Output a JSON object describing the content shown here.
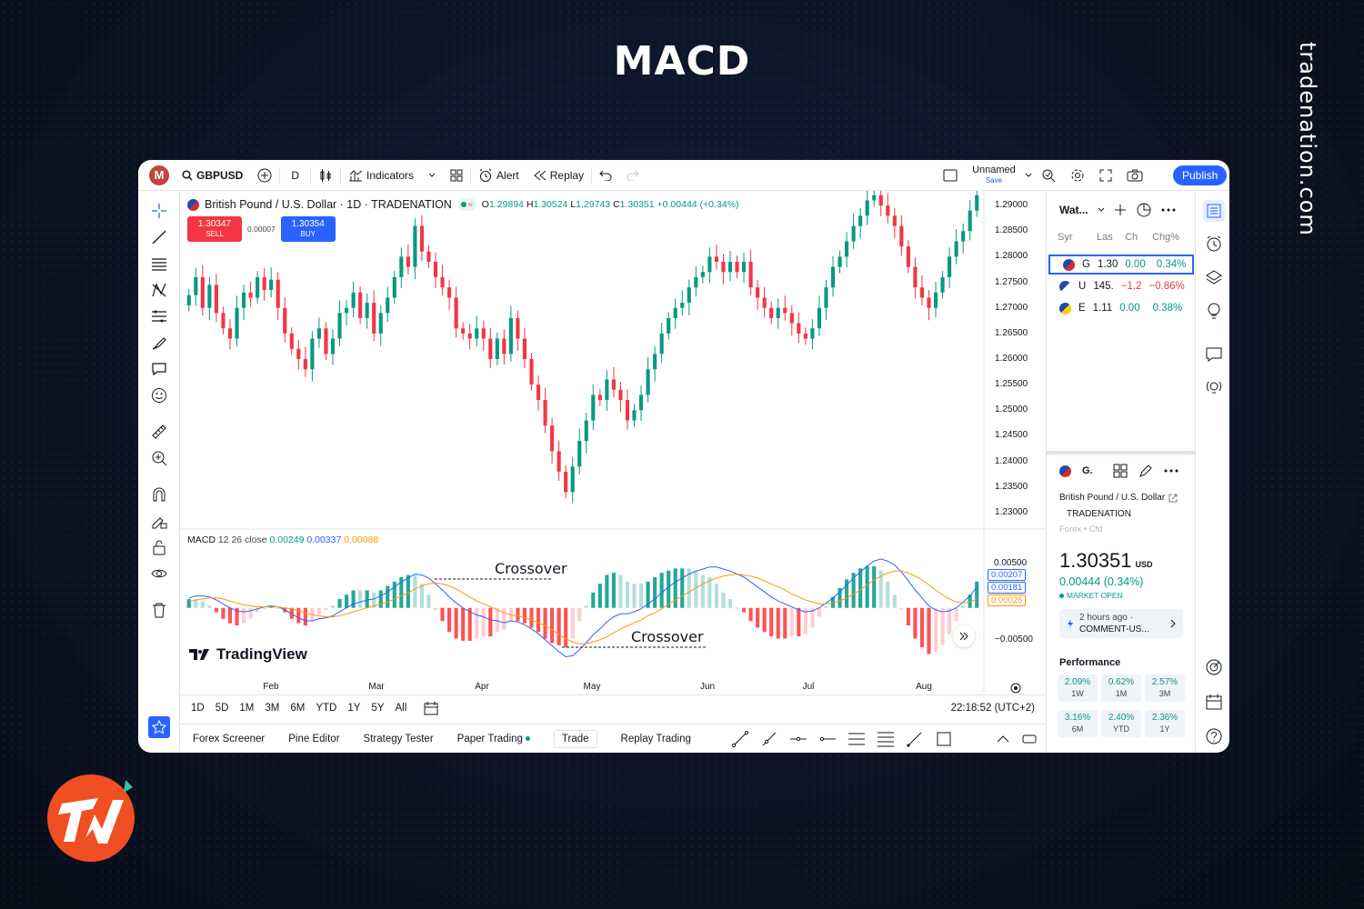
{
  "page": {
    "headline": "MACD",
    "brand": "tradenation.com"
  },
  "topbar": {
    "avatar": "M",
    "symbol": "GBPUSD",
    "interval": "D",
    "indicators": "Indicators",
    "alert": "Alert",
    "replay": "Replay",
    "layout_name": "Unnamed",
    "layout_sub": "Save",
    "publish": "Publish"
  },
  "legend": {
    "title": "British Pound / U.S. Dollar · 1D · TRADENATION",
    "o_label": "O",
    "o": "1.29894",
    "h_label": "H",
    "h": "1.30524",
    "l_label": "L",
    "l": "1.29743",
    "c_label": "C",
    "c": "1.30351",
    "chg": "+0.00444 (+0.34%)"
  },
  "trade": {
    "sell_price": "1.30347",
    "sell_label": "SELL",
    "spread": "0.00007",
    "buy_price": "1.30354",
    "buy_label": "BUY"
  },
  "macd_legend": {
    "label": "MACD",
    "params": "12 26 close",
    "macd": "0.00249",
    "signal": "0.00337",
    "hist": "0.00088"
  },
  "annotations": {
    "cross1": "Crossover",
    "cross2": "Crossover"
  },
  "tv_logo": "TradingView",
  "price_axis": [
    "1.29000",
    "1.28500",
    "1.28000",
    "1.27500",
    "1.27000",
    "1.26500",
    "1.26000",
    "1.25500",
    "1.25000",
    "1.24500",
    "1.24000",
    "1.23500",
    "1.23000"
  ],
  "macd_axis": [
    "0.00500",
    "−0.00500"
  ],
  "macd_tags": [
    "0.00207",
    "0.00181",
    "0.00026"
  ],
  "time_axis": [
    "Feb",
    "Mar",
    "Apr",
    "May",
    "Jun",
    "Jul",
    "Aug"
  ],
  "ranges": [
    "1D",
    "5D",
    "1M",
    "3M",
    "6M",
    "YTD",
    "1Y",
    "5Y",
    "All"
  ],
  "clock": "22:18:52 (UTC+2)",
  "bottom_tabs": [
    "Forex Screener",
    "Pine Editor",
    "Strategy Tester",
    "Paper Trading",
    "Trade",
    "Replay Trading"
  ],
  "watchlist": {
    "title": "Wat...",
    "cols": [
      "Syr",
      "Las",
      "Ch",
      "Chg%"
    ],
    "rows": [
      {
        "sym": "G",
        "last": "1.30",
        "chg": "0.00",
        "pct": "0.34%",
        "dir": "up"
      },
      {
        "sym": "U",
        "last": "145.",
        "chg": "−1.2",
        "pct": "−0.86%",
        "dir": "down"
      },
      {
        "sym": "E",
        "last": "1.11",
        "chg": "0.00",
        "pct": "0.38%",
        "dir": "up"
      }
    ]
  },
  "details": {
    "sym": "G.",
    "name": "British Pound / U.S. Dollar",
    "exchange": "TRADENATION",
    "type": "Forex • Cfd",
    "price": "1.30351",
    "currency": "USD",
    "change": "0.00444 (0.34%)",
    "status": "MARKET OPEN",
    "news_time": "2 hours ago ·",
    "news_title": "COMMENT-US...",
    "perf_title": "Performance",
    "perf": [
      {
        "v": "2.09%",
        "l": "1W"
      },
      {
        "v": "0.62%",
        "l": "1M"
      },
      {
        "v": "2.57%",
        "l": "3M"
      },
      {
        "v": "3.16%",
        "l": "6M"
      },
      {
        "v": "2.40%",
        "l": "YTD"
      },
      {
        "v": "2.36%",
        "l": "1Y"
      }
    ]
  },
  "colors": {
    "up": "#089981",
    "down": "#f23645",
    "macd_line": "#2962ff",
    "signal_line": "#ff9800",
    "accent": "#2962ff"
  },
  "chart_data": {
    "type": "candlestick+macd",
    "closes": [
      1.2725,
      1.276,
      1.27,
      1.2745,
      1.269,
      1.266,
      1.264,
      1.27,
      1.273,
      1.272,
      1.276,
      1.2735,
      1.2755,
      1.27,
      1.265,
      1.262,
      1.26,
      1.258,
      1.264,
      1.266,
      1.261,
      1.264,
      1.269,
      1.27,
      1.273,
      1.268,
      1.271,
      1.265,
      1.269,
      1.272,
      1.276,
      1.28,
      1.278,
      1.286,
      1.281,
      1.279,
      1.276,
      1.274,
      1.272,
      1.266,
      1.265,
      1.264,
      1.266,
      1.264,
      1.26,
      1.264,
      1.261,
      1.268,
      1.264,
      1.26,
      1.255,
      1.252,
      1.247,
      1.242,
      1.238,
      1.234,
      1.239,
      1.244,
      1.248,
      1.253,
      1.252,
      1.256,
      1.254,
      1.252,
      1.248,
      1.25,
      1.253,
      1.258,
      1.261,
      1.265,
      1.268,
      1.27,
      1.271,
      1.274,
      1.276,
      1.277,
      1.28,
      1.279,
      1.277,
      1.279,
      1.277,
      1.279,
      1.274,
      1.272,
      1.27,
      1.268,
      1.27,
      1.269,
      1.267,
      1.265,
      1.264,
      1.266,
      1.27,
      1.274,
      1.278,
      1.28,
      1.283,
      1.286,
      1.288,
      1.291,
      1.292,
      1.29,
      1.288,
      1.286,
      1.282,
      1.278,
      1.274,
      1.272,
      1.27,
      1.273,
      1.276,
      1.28,
      1.283,
      1.285,
      1.289,
      1.292
    ],
    "macd": [
      0.001,
      0.0012,
      0.0012,
      0.0011,
      0.0008,
      0.0004,
      0.0,
      -0.0003,
      -0.0004,
      -0.0003,
      -0.0001,
      0.0001,
      0.0002,
      0.0001,
      -0.0002,
      -0.0006,
      -0.001,
      -0.0013,
      -0.0013,
      -0.0011,
      -0.001,
      -0.0008,
      -0.0004,
      0.0,
      0.0004,
      0.0006,
      0.0008,
      0.0009,
      0.0012,
      0.0016,
      0.0021,
      0.0026,
      0.003,
      0.0034,
      0.0033,
      0.003,
      0.0024,
      0.0018,
      0.0011,
      0.0005,
      0.0,
      -0.0004,
      -0.0007,
      -0.0009,
      -0.0012,
      -0.0013,
      -0.0015,
      -0.0013,
      -0.0014,
      -0.0017,
      -0.0021,
      -0.0026,
      -0.0032,
      -0.0038,
      -0.0044,
      -0.0049,
      -0.0048,
      -0.0042,
      -0.0035,
      -0.0027,
      -0.0021,
      -0.0014,
      -0.0009,
      -0.0006,
      -0.0006,
      -0.0004,
      -0.0001,
      0.0004,
      0.0009,
      0.0015,
      0.0021,
      0.0026,
      0.003,
      0.0034,
      0.0037,
      0.0039,
      0.0041,
      0.0041,
      0.0039,
      0.0037,
      0.0034,
      0.0031,
      0.0026,
      0.0021,
      0.0016,
      0.0011,
      0.0007,
      0.0004,
      0.0001,
      -0.0002,
      -0.0004,
      -0.0003,
      0.0,
      0.0005,
      0.001,
      0.0016,
      0.0023,
      0.003,
      0.0036,
      0.0042,
      0.0047,
      0.0049,
      0.0047,
      0.0043,
      0.0036,
      0.0027,
      0.0018,
      0.001,
      0.0002,
      -0.0002,
      -0.0004,
      -0.0003,
      0.0,
      0.0006,
      0.0012,
      0.0021
    ],
    "signal": [
      0.0006,
      0.0008,
      0.0009,
      0.001,
      0.001,
      0.0009,
      0.0007,
      0.0005,
      0.0003,
      0.0002,
      0.0001,
      0.0001,
      0.0001,
      0.0001,
      0.0,
      -0.0001,
      -0.0003,
      -0.0005,
      -0.0007,
      -0.0008,
      -0.0009,
      -0.0009,
      -0.0008,
      -0.0006,
      -0.0004,
      -0.0002,
      0.0,
      0.0002,
      0.0004,
      0.0006,
      0.0009,
      0.0012,
      0.0015,
      0.0019,
      0.0022,
      0.0024,
      0.0025,
      0.0024,
      0.0022,
      0.0019,
      0.0015,
      0.0011,
      0.0007,
      0.0004,
      0.0001,
      -0.0002,
      -0.0005,
      -0.0007,
      -0.0008,
      -0.001,
      -0.0012,
      -0.0015,
      -0.0018,
      -0.0022,
      -0.0027,
      -0.0031,
      -0.0034,
      -0.0036,
      -0.0036,
      -0.0034,
      -0.0032,
      -0.0029,
      -0.0025,
      -0.0021,
      -0.0018,
      -0.0015,
      -0.0012,
      -0.0008,
      -0.0005,
      -0.0001,
      0.0004,
      0.0008,
      0.0012,
      0.0016,
      0.002,
      0.0024,
      0.0027,
      0.003,
      0.0032,
      0.0033,
      0.0034,
      0.0033,
      0.0032,
      0.003,
      0.0027,
      0.0024,
      0.0021,
      0.0018,
      0.0014,
      0.0011,
      0.0008,
      0.0006,
      0.0004,
      0.0004,
      0.0005,
      0.0007,
      0.001,
      0.0014,
      0.0018,
      0.0023,
      0.0028,
      0.0032,
      0.0035,
      0.0037,
      0.0037,
      0.0035,
      0.0032,
      0.0028,
      0.0023,
      0.0018,
      0.0013,
      0.0009,
      0.0006,
      0.0005,
      0.0006,
      0.0009
    ],
    "ylim": [
      1.2275,
      1.2925
    ],
    "macd_ylim": [
      -0.0065,
      0.007
    ]
  }
}
